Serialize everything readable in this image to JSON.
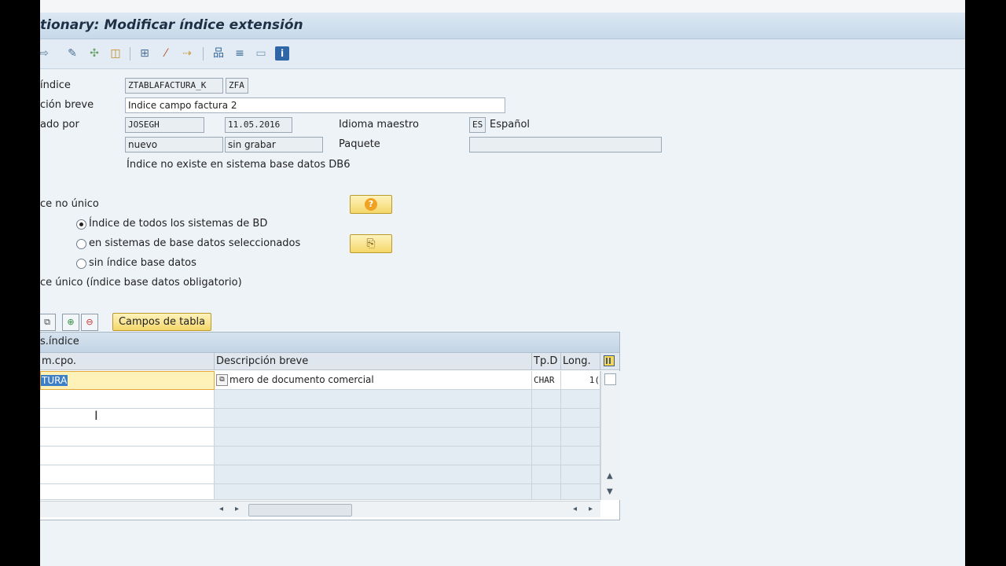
{
  "window": {
    "title": "tionary: Modificar índice extensión"
  },
  "toolbar": {
    "icons": [
      "back-arrow-icon",
      "display-change-icon",
      "other-object-icon",
      "activate-icon",
      "where-used-icon",
      "magic-wand-icon",
      "move-icon",
      "hierarchy-icon",
      "align-icon",
      "layout-icon",
      "info-icon"
    ]
  },
  "form": {
    "index_label": "índice",
    "index_table": "ZTABLAFACTURA_K",
    "index_id": "ZFA",
    "desc_label": "ción breve",
    "desc_value": "Indice campo factura 2",
    "modified_label": "ado por",
    "user": "JOSEGH",
    "date": "11.05.2016",
    "lang_label": "Idioma maestro",
    "lang_code": "ES",
    "lang_name": "Español",
    "status1": "nuevo",
    "status2": "sin grabar",
    "package_label": "Paquete",
    "package_value": "",
    "db_note": "Índice no existe en sistema base datos DB6"
  },
  "options": {
    "non_unique_label": "ce no único",
    "radio1": "Índice de todos los sistemas de BD",
    "radio2": "en sistemas de base datos seleccionados",
    "radio3": "sin índice base datos",
    "unique_label": "ce único (índice base datos obligatorio)"
  },
  "grid_toolbar": {
    "campos_button": "Campos de tabla"
  },
  "grid": {
    "title": "s.índice",
    "columns": [
      "m.cpo.",
      "Descripción breve",
      "Tp.D",
      "Long."
    ],
    "rows": [
      {
        "field": "TURA",
        "desc": "mero de documento comercial",
        "type": "CHAR",
        "len": "1("
      }
    ]
  },
  "colors": {
    "accent_yellow": "#f4d76a",
    "title_bg": "#c7d9ea",
    "screen_bg": "#eef3f8"
  }
}
